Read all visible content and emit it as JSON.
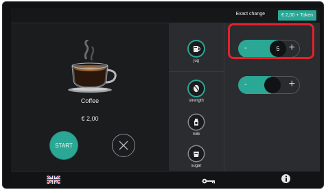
{
  "topbar": {
    "exact_change": "Exact change",
    "token_button": "€ 2,00  + Token"
  },
  "product": {
    "name": "Coffee",
    "price": "€ 2,00",
    "image_icon": "coffee-cup-icon"
  },
  "actions": {
    "start": "START",
    "cancel_icon": "close-icon"
  },
  "options": [
    {
      "label": "jug",
      "icon": "jug-icon",
      "active": true
    },
    {
      "label": "strength",
      "icon": "strength-icon",
      "active": true
    },
    {
      "label": "milk",
      "icon": "milk-icon",
      "active": false
    },
    {
      "label": "sugar",
      "icon": "sugar-icon",
      "active": false
    }
  ],
  "steppers": {
    "jug": {
      "minus": "-",
      "value": "5",
      "plus": "+"
    },
    "strength": {
      "minus": "-",
      "value": "",
      "plus": "+"
    }
  },
  "bottombar": {
    "language_icon": "uk-flag-icon",
    "service_icon": "key-icon",
    "info_icon": "info-icon"
  },
  "colors": {
    "accent": "#2aa895",
    "highlight": "#e5212b",
    "background": "#1a1b1d",
    "panel": "#2b2c2f"
  }
}
